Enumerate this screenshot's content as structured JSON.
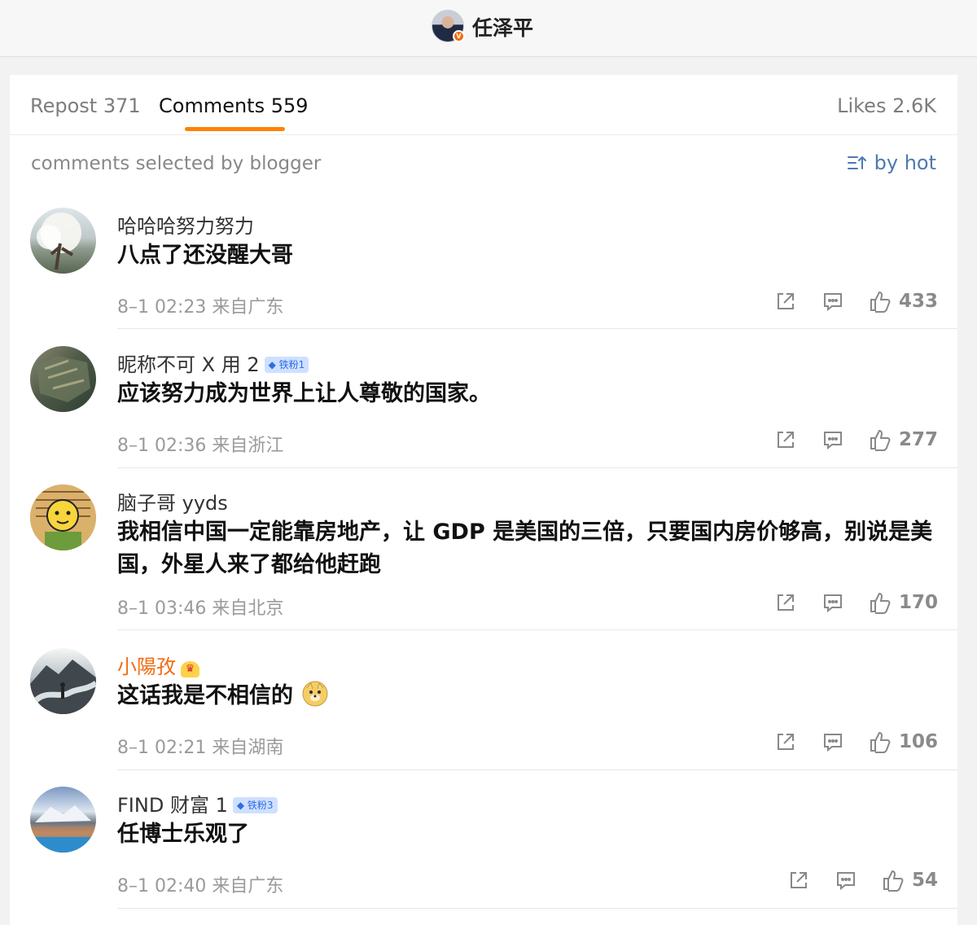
{
  "header": {
    "user_name": "任泽平"
  },
  "tabs": [
    {
      "label": "Repost",
      "count": "371"
    },
    {
      "label": "Comments",
      "count": "559"
    },
    {
      "label": "Likes",
      "count": "2.6K"
    }
  ],
  "section": {
    "title": "comments selected by blogger",
    "sort_label": "by hot"
  },
  "comments": [
    {
      "username": "哈哈哈努力努力",
      "text": "八点了还没醒大哥",
      "time": "8–1 02:23",
      "location": "来自广东",
      "likes": "433"
    },
    {
      "username": "昵称不可 X 用 2",
      "badge": "铁粉1",
      "text": "应该努力成为世界上让人尊敬的国家。",
      "time": "8–1 02:36",
      "location": "来自浙江",
      "likes": "277"
    },
    {
      "username": "脑子哥 yyds",
      "text": "我相信中国一定能靠房地产，让 GDP 是美国的三倍，只要国内房价够高，别说是美国，外星人来了都给他赶跑",
      "time": "8–1 03:46",
      "location": "来自北京",
      "likes": "170"
    },
    {
      "username": "小陽孜",
      "text": "这话我是不相信的",
      "time": "8–1 02:21",
      "location": "来自湖南",
      "likes": "106"
    },
    {
      "username": "FIND 财富 1",
      "badge": "铁粉3",
      "text": "任博士乐观了",
      "time": "8–1 02:40",
      "location": "来自广东",
      "likes": "54"
    }
  ]
}
